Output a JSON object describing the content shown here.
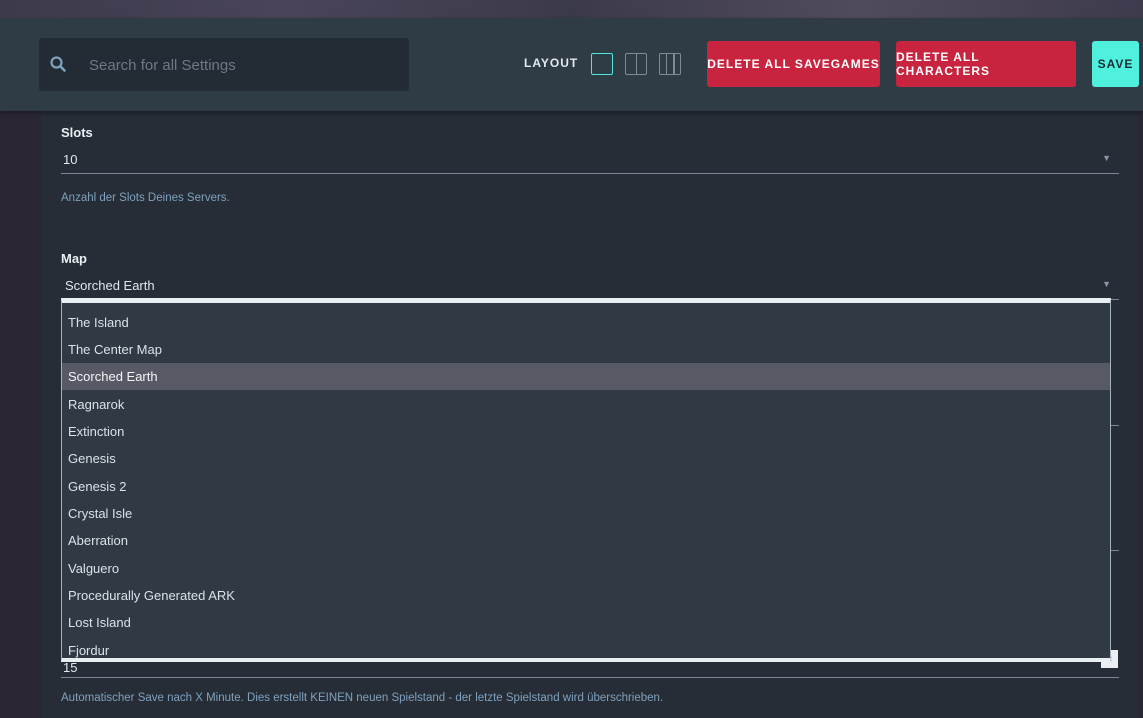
{
  "toolbar": {
    "search": {
      "placeholder": "Search for all Settings",
      "value": ""
    },
    "layout_label": "LAYOUT",
    "layout_options": [
      "single-column",
      "two-column",
      "three-column"
    ],
    "layout_selected": "single-column",
    "delete_savegames_label": "DELETE ALL SAVEGAMES",
    "delete_characters_label": "DELETE ALL CHARACTERS",
    "save_label": "SAVE"
  },
  "settings": {
    "slots": {
      "label": "Slots",
      "value": "10",
      "help": "Anzahl der Slots Deines Servers."
    },
    "map": {
      "label": "Map",
      "value": "Scorched Earth",
      "options": [
        "The Island",
        "The Center Map",
        "Scorched Earth",
        "Ragnarok",
        "Extinction",
        "Genesis",
        "Genesis 2",
        "Crystal Isle",
        "Aberration",
        "Valguero",
        "Procedurally Generated ARK",
        "Lost Island",
        "Fjordur"
      ]
    },
    "autosave": {
      "value": "15",
      "help": "Automatischer Save nach X Minute. Dies erstellt KEINEN neuen Spielstand - der letzte Spielstand wird überschrieben."
    }
  },
  "colors": {
    "background": "#262d37",
    "toolbar": "#2f3b45",
    "danger": "#c8243f",
    "accent": "#4ff0dd",
    "help_text": "#7fa1bd",
    "selected_option": "#575964"
  },
  "icons": {
    "search": "search-icon",
    "dropdown": "chevron-down-icon"
  }
}
